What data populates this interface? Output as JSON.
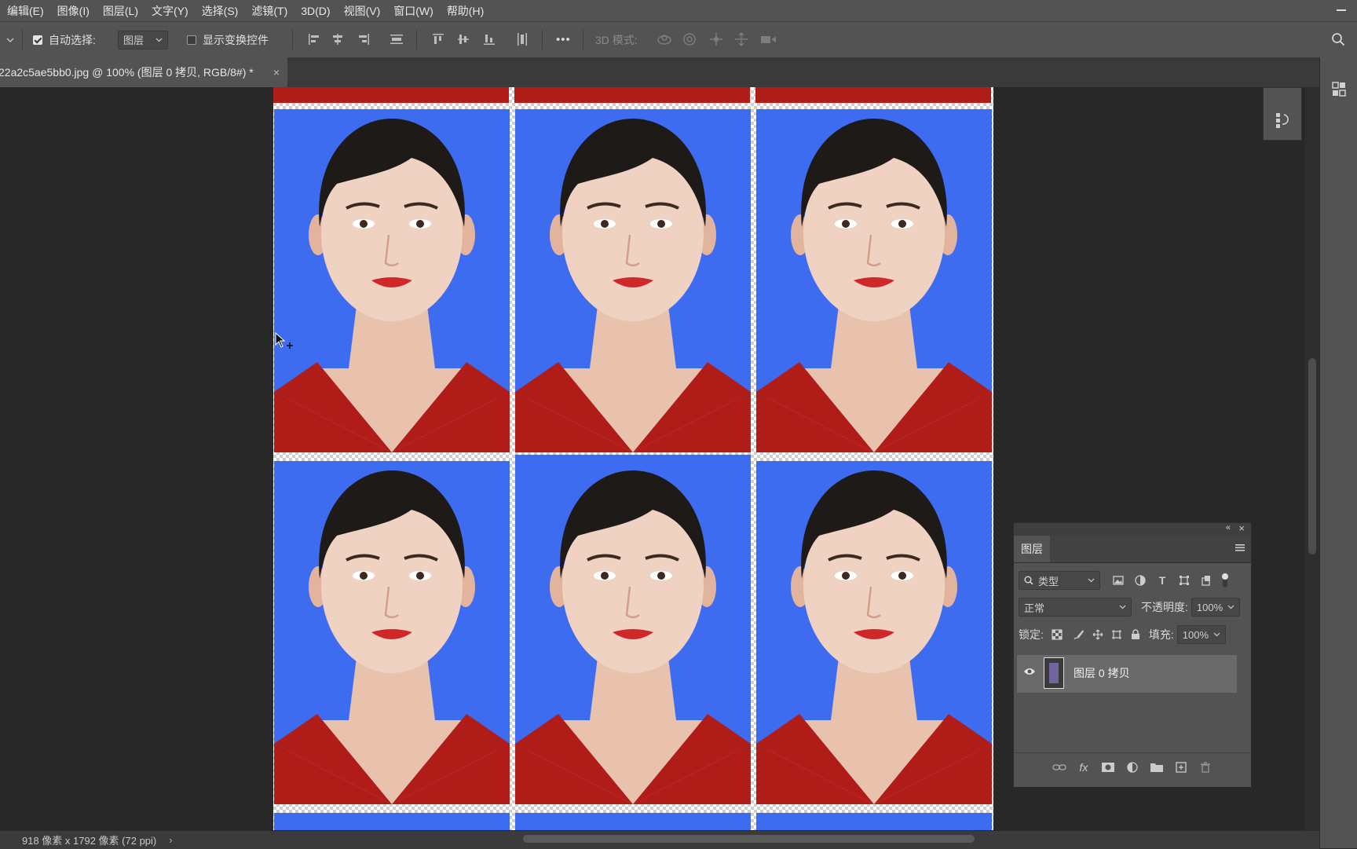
{
  "menu": [
    "编辑(E)",
    "图像(I)",
    "图层(L)",
    "文字(Y)",
    "选择(S)",
    "滤镜(T)",
    "3D(D)",
    "视图(V)",
    "窗口(W)",
    "帮助(H)"
  ],
  "options": {
    "auto_select_label": "自动选择:",
    "auto_select_target": "图层",
    "show_transform_label": "显示变换控件",
    "more": "•••",
    "mode_3d_label": "3D 模式:"
  },
  "document_tab": {
    "title": "22a2c5ae5bb0.jpg @ 100% (图层 0 拷贝, RGB/8#) *",
    "close": "×"
  },
  "status": {
    "dimensions": "918 像素 x 1792 像素 (72 ppi)",
    "arrow": "›"
  },
  "colors": {
    "photo_background": "#3e6cf0",
    "shirt": "#b01c18",
    "ui_panel": "#535353"
  },
  "layers_panel": {
    "tab_label": "图层",
    "filter_label": "类型",
    "blend_mode": "正常",
    "opacity_label": "不透明度:",
    "opacity_value": "100%",
    "lock_label": "锁定:",
    "fill_label": "填充:",
    "fill_value": "100%",
    "layer_name": "图层 0 拷贝"
  }
}
